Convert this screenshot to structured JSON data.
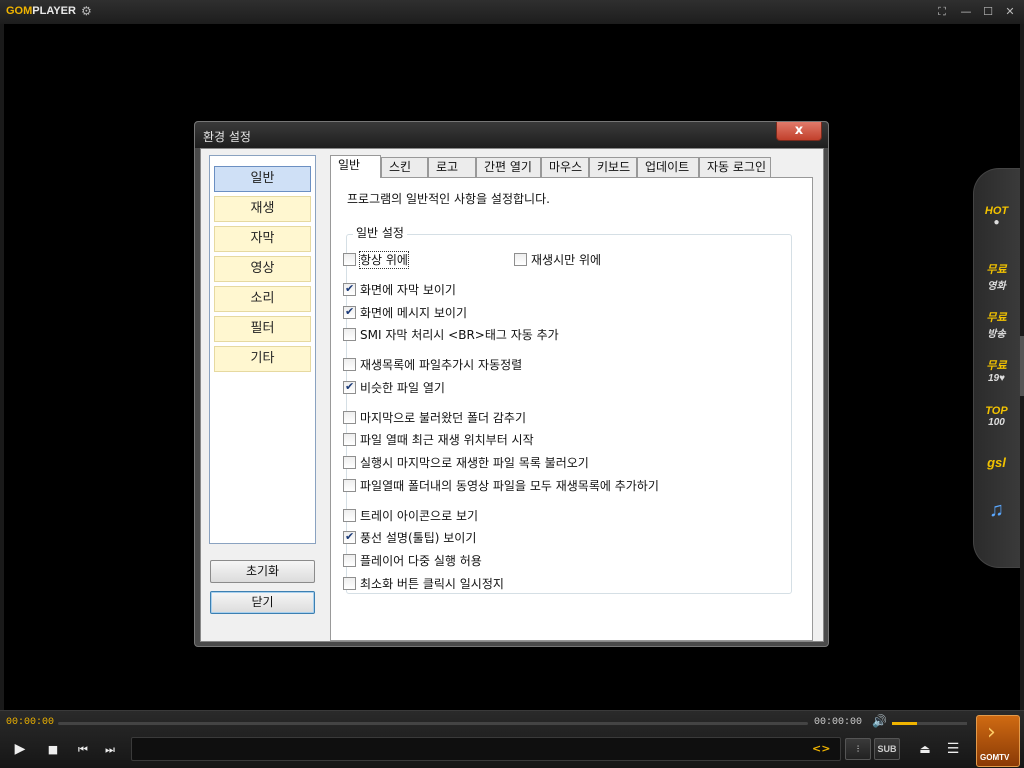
{
  "app": {
    "logo_gom": "GOM",
    "logo_player": "PLAYER",
    "window_buttons": [
      "resize-icon",
      "minimize-icon",
      "maximize-icon",
      "close-icon"
    ]
  },
  "sidepanel": {
    "items": [
      {
        "l1": "HOT",
        "l2": ""
      },
      {
        "l1": "무료",
        "l2": "영화"
      },
      {
        "l1": "무료",
        "l2": "방송"
      },
      {
        "l1": "무료",
        "l2": "19♥"
      },
      {
        "l1": "TOP",
        "l2": "100"
      },
      {
        "l1": "gsl",
        "l2": ""
      },
      {
        "l1": "",
        "l2": ""
      }
    ]
  },
  "dialog": {
    "title": "환경 설정",
    "close_label": "x",
    "nav": [
      "일반",
      "재생",
      "자막",
      "영상",
      "소리",
      "필터",
      "기타"
    ],
    "reset_label": "초기화",
    "close_button_label": "닫기",
    "tabs": [
      "일반",
      "스킨",
      "로고",
      "간편 열기",
      "마우스",
      "키보드",
      "업데이트",
      "자동 로그인"
    ],
    "description": "프로그램의 일반적인 사항을 설정합니다.",
    "group_title": "일반 설정",
    "checkboxes": [
      {
        "label": "항상 위에",
        "checked": false
      },
      {
        "label": "재생시만 위에",
        "checked": false
      },
      {
        "label": "화면에 자막 보이기",
        "checked": true
      },
      {
        "label": "화면에 메시지 보이기",
        "checked": true
      },
      {
        "label": "SMI 자막 처리시 <BR>태그 자동 추가",
        "checked": false
      },
      {
        "label": "재생목록에 파일추가시 자동정렬",
        "checked": false
      },
      {
        "label": "비슷한 파일 열기",
        "checked": true
      },
      {
        "label": "마지막으로 불러왔던 폴더 감추기",
        "checked": false
      },
      {
        "label": "파일 열때 최근 재생 위치부터 시작",
        "checked": false
      },
      {
        "label": "실행시 마지막으로 재생한 파일 목록 불러오기",
        "checked": false
      },
      {
        "label": "파일열때 폴더내의 동영상 파일을 모두 재생목록에 추가하기",
        "checked": false
      },
      {
        "label": "트레이 아이콘으로 보기",
        "checked": false
      },
      {
        "label": "풍선 설명(툴팁) 보이기",
        "checked": true
      },
      {
        "label": "플레이어 다중 실행 허용",
        "checked": false
      },
      {
        "label": "최소화 버튼 클릭시 일시정지",
        "checked": false
      }
    ]
  },
  "controls": {
    "time_current": "00:00:00",
    "time_total": "00:00:00",
    "volume_fraction": 0.33,
    "sub_label": "SUB",
    "bracket_label": "<>",
    "gomtv_label": "GOMTV"
  },
  "colors": {
    "accent": "#f0b400",
    "nav_bg": "#fff7d0",
    "nav_selected": "#cfe0f6"
  }
}
